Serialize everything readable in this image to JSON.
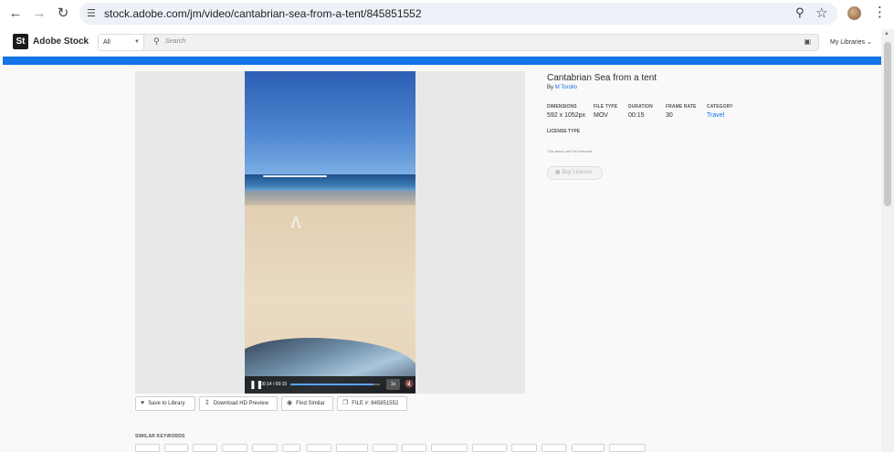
{
  "browser": {
    "url": "stock.adobe.com/jm/video/cantabrian-sea-from-a-tent/845851552",
    "back_icon": "arrow-left-icon",
    "forward_icon": "arrow-right-icon",
    "reload_icon": "reload-icon"
  },
  "header": {
    "logo": "St",
    "brand": "Adobe Stock",
    "category": "All",
    "search_placeholder": "Search",
    "my_libraries": "My Libraries"
  },
  "video": {
    "time": "00:14 / 00:15",
    "rate": "1x",
    "progress": 0.93
  },
  "actions": {
    "save": "Save to Library",
    "download": "Download HD Preview",
    "similar": "Find Similar",
    "file": "FILE #:  845851552"
  },
  "details": {
    "title": "Cantabrian Sea from a tent",
    "by_prefix": "By",
    "author": "M Torollo",
    "dimensions_label": "DIMENSIONS",
    "dimensions": "592 x 1052px",
    "filetype_label": "FILE TYPE",
    "filetype": "MOV",
    "duration_label": "DURATION",
    "duration": "00:15",
    "framerate_label": "FRAME RATE",
    "framerate": "30",
    "category_label": "CATEGORY",
    "category": "Travel",
    "license_type_label": "LICENSE TYPE",
    "license_note": "This asset can't be licensed.",
    "buy_button": "Buy License"
  },
  "similar_keywords_label": "SIMILAR KEYWORDS"
}
